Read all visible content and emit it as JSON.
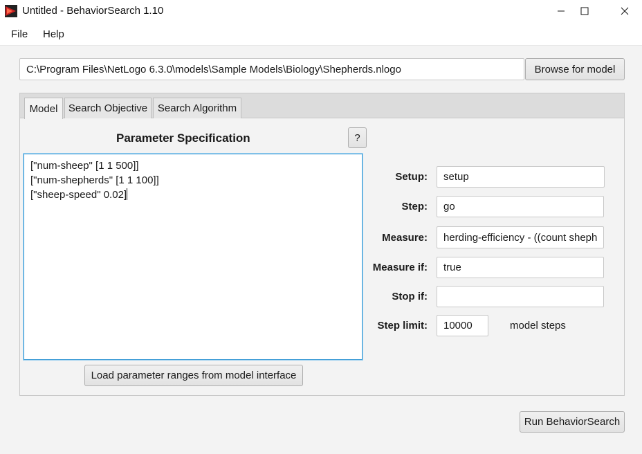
{
  "window": {
    "title": "Untitled - BehaviorSearch 1.10",
    "controls": {
      "minimize": "minimize-icon",
      "maximize": "maximize-icon",
      "close": "close-icon"
    }
  },
  "menu": {
    "file": "File",
    "help": "Help"
  },
  "model_path": "C:\\Program Files\\NetLogo 6.3.0\\models\\Sample Models\\Biology\\Shepherds.nlogo",
  "browse_label": "Browse for model",
  "tabs": [
    {
      "label": "Model",
      "active": true
    },
    {
      "label": "Search Objective",
      "active": false
    },
    {
      "label": "Search Algorithm",
      "active": false
    }
  ],
  "param_spec": {
    "title": "Parameter Specification",
    "help_label": "?",
    "lines": [
      "[\"num-sheep\" [1 1 500]]",
      "[\"num-shepherds\" [1 1 100]]",
      "[\"sheep-speed\" 0.02]"
    ],
    "load_label": "Load parameter ranges from model interface"
  },
  "form": {
    "setup": {
      "label": "Setup:",
      "value": "setup"
    },
    "step": {
      "label": "Step:",
      "value": "go"
    },
    "measure": {
      "label": "Measure:",
      "value": "herding-efficiency - ((count sheph"
    },
    "measure_if": {
      "label": "Measure if:",
      "value": "true"
    },
    "stop_if": {
      "label": "Stop if:",
      "value": ""
    },
    "step_limit": {
      "label": "Step limit:",
      "value": "10000",
      "unit": "model steps"
    }
  },
  "run_label": "Run BehaviorSearch",
  "colors": {
    "focus_border": "#3c9bd6",
    "app_icon": "#cc2222"
  }
}
